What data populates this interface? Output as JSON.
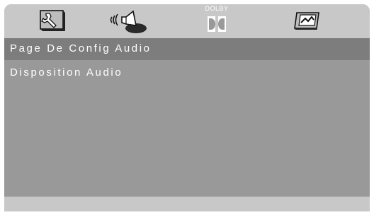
{
  "toolbar": {
    "tabs": [
      {
        "icon": "wrench-settings-icon",
        "selected": false
      },
      {
        "icon": "speaker-audio-icon",
        "selected": true
      },
      {
        "icon": "dolby-icon",
        "label": "DOLBY",
        "selected": false
      },
      {
        "icon": "video-screen-icon",
        "selected": false
      }
    ]
  },
  "page_header": {
    "title": "Page De Config Audio"
  },
  "menu": {
    "items": [
      {
        "label": "Disposition Audio"
      }
    ]
  },
  "colors": {
    "toolbar_bg": "#c8c8c8",
    "panel_bg": "#999999",
    "header_bg": "#7d7d7d",
    "text": "#ffffff"
  }
}
